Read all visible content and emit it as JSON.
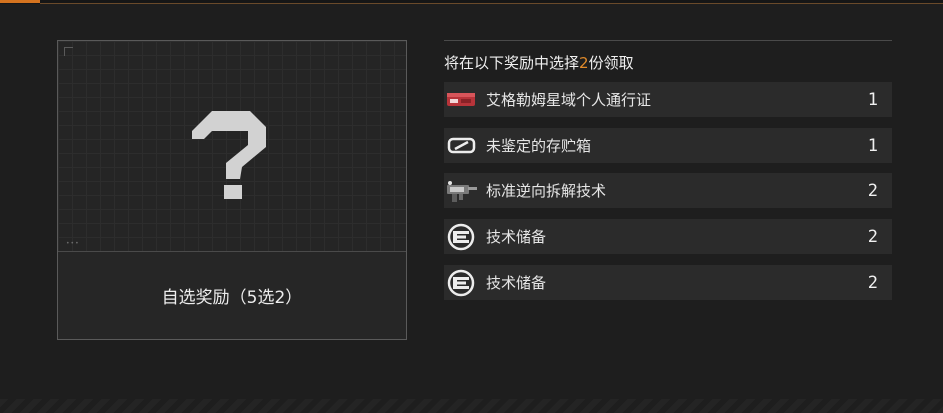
{
  "reward_card": {
    "caption": "自选奖励（5选2）",
    "icon": "question-mark-icon"
  },
  "selection_panel": {
    "heading_prefix": "将在以下奖励中选择",
    "heading_count": "2",
    "heading_suffix": "份领取",
    "accent_color": "#e08a2a",
    "items": [
      {
        "name": "艾格勒姆星域个人通行证",
        "quantity": "1",
        "icon": "pass-ticket-icon"
      },
      {
        "name": "未鉴定的存贮箱",
        "quantity": "1",
        "icon": "storage-box-icon"
      },
      {
        "name": "标准逆向拆解技术",
        "quantity": "2",
        "icon": "weapon-tech-icon"
      },
      {
        "name": "技术储备",
        "quantity": "2",
        "icon": "tech-reserve-icon"
      },
      {
        "name": "技术储备",
        "quantity": "2",
        "icon": "tech-reserve-icon"
      }
    ]
  }
}
